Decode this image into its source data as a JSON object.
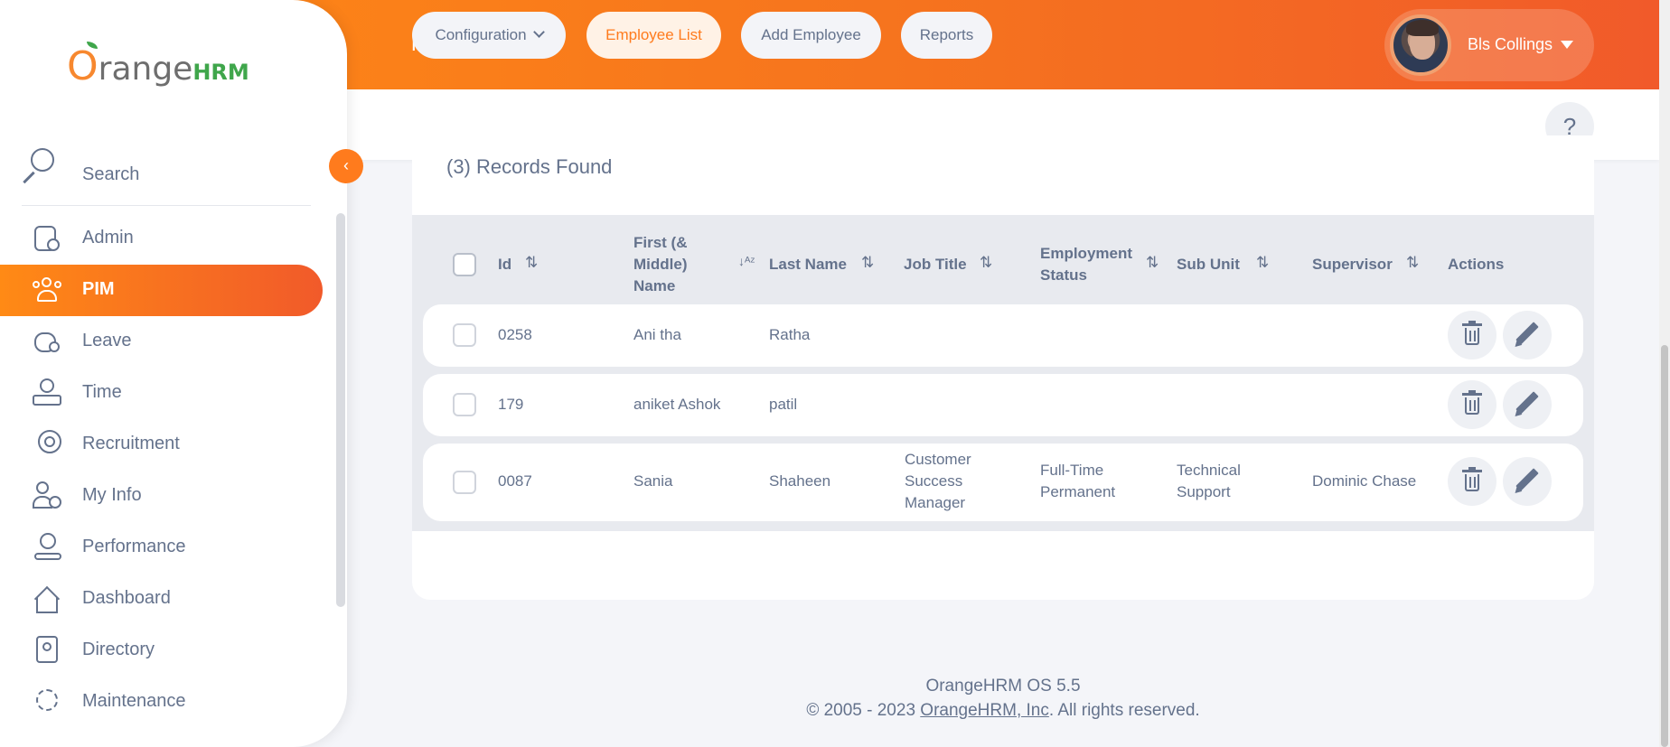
{
  "header": {
    "title": "PIM",
    "user_name": "Bls Collings"
  },
  "subnav": {
    "configuration": "Configuration",
    "employee_list": "Employee List",
    "add_employee": "Add Employee",
    "reports": "Reports",
    "help": "?"
  },
  "sidebar": {
    "logo_o": "O",
    "logo_range": "range",
    "logo_hrm": "HRM",
    "search": "Search",
    "collapse": "‹",
    "items": [
      {
        "label": "Admin"
      },
      {
        "label": "PIM"
      },
      {
        "label": "Leave"
      },
      {
        "label": "Time"
      },
      {
        "label": "Recruitment"
      },
      {
        "label": "My Info"
      },
      {
        "label": "Performance"
      },
      {
        "label": "Dashboard"
      },
      {
        "label": "Directory"
      },
      {
        "label": "Maintenance"
      }
    ]
  },
  "records": "(3) Records Found",
  "table": {
    "headers": {
      "id": "Id",
      "first_name_1": "First (&",
      "first_name_2": "Middle)",
      "first_name_3": "Name",
      "last_name": "Last Name",
      "job_title": "Job Title",
      "employment_status_1": "Employment",
      "employment_status_2": "Status",
      "sub_unit": "Sub Unit",
      "supervisor": "Supervisor",
      "actions": "Actions"
    },
    "sort_icon": "⇅",
    "sort_az_icon": "↓ᴬᶻ",
    "rows": [
      {
        "id": "0258",
        "first": "Ani tha",
        "last": "Ratha",
        "job_1": "",
        "job_2": "",
        "job_3": "",
        "status_1": "",
        "status_2": "",
        "unit_1": "",
        "unit_2": "",
        "supervisor": ""
      },
      {
        "id": "179",
        "first": "aniket Ashok",
        "last": "patil",
        "job_1": "",
        "job_2": "",
        "job_3": "",
        "status_1": "",
        "status_2": "",
        "unit_1": "",
        "unit_2": "",
        "supervisor": ""
      },
      {
        "id": "0087",
        "first": "Sania",
        "last": "Shaheen",
        "job_1": "Customer",
        "job_2": "Success",
        "job_3": "Manager",
        "status_1": "Full-Time",
        "status_2": "Permanent",
        "unit_1": "Technical",
        "unit_2": "Support",
        "supervisor": "Dominic Chase"
      }
    ]
  },
  "footer": {
    "version": "OrangeHRM OS 5.5",
    "copyright_prefix": "© 2005 - 2023 ",
    "company_link": "OrangeHRM, Inc",
    "copyright_suffix": ". All rights reserved."
  },
  "colors": {
    "accent": "#ff7b1d",
    "text": "#64728c",
    "header_start": "#ff8a15",
    "header_end": "#f15a2a"
  }
}
